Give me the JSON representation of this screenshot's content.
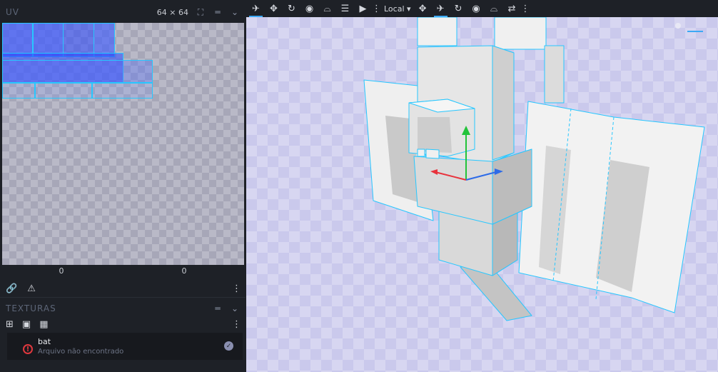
{
  "uv_panel": {
    "title": "UV",
    "size": "64 × 64",
    "coord_left": "0",
    "coord_right": "0"
  },
  "textures_panel": {
    "title": "TEXTURAS",
    "texture": {
      "name": "bat",
      "status": "Arquivo não encontrado"
    }
  },
  "toolbar": {
    "space_label": "Local"
  },
  "icons": {
    "uv_toolbar": [
      "link-icon",
      "warning-icon",
      "more-vertical-icon"
    ],
    "texture_toolbar": [
      "add-texture-icon",
      "import-texture-icon",
      "create-texture-icon",
      "more-vertical-icon"
    ],
    "main_toolbar": [
      "move-tool-icon",
      "resize-tool-icon",
      "rotate-tool-icon",
      "pivot-tool-icon",
      "vertex-snap-icon",
      "filter-icon",
      "play-icon",
      "more-vertical-icon",
      "space-dropdown",
      "move-icon",
      "resize-icon",
      "rotate-icon",
      "pivot-icon",
      "snap-icon",
      "mirror-icon",
      "more-vertical-icon"
    ]
  },
  "colors": {
    "accent": "#3da9f5",
    "error": "#e0383e",
    "selection_outline": "#27c7ff",
    "gizmo_x": "#e8323c",
    "gizmo_y": "#22c33a",
    "gizmo_z": "#2d6be8"
  }
}
